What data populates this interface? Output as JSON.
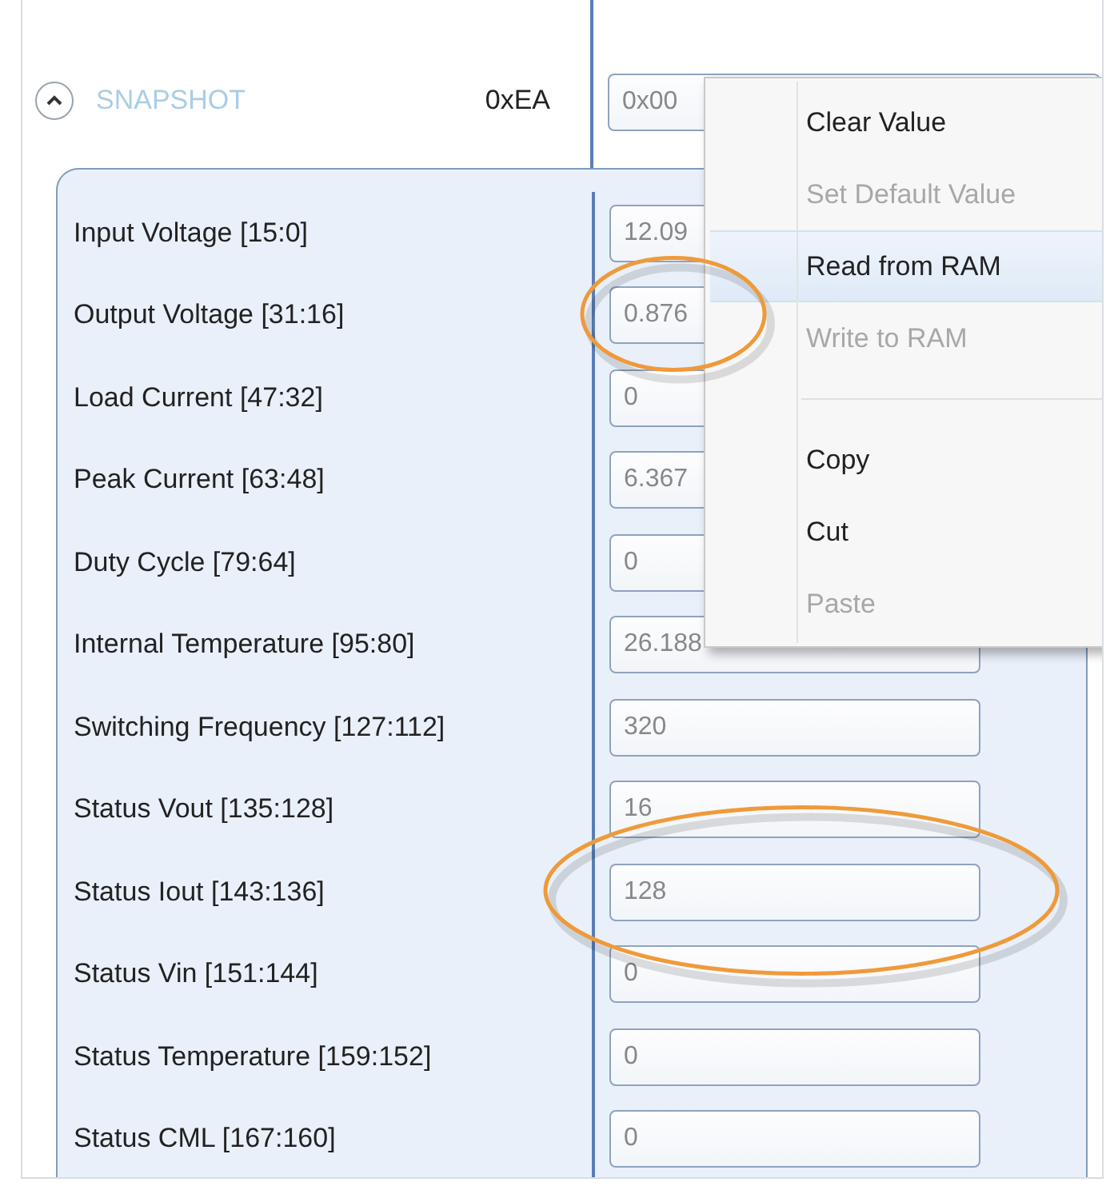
{
  "section": {
    "title": "SNAPSHOT",
    "expanded": true,
    "address": "0xEA",
    "value": "0x00"
  },
  "fields": [
    {
      "label": "Input Voltage [15:0]",
      "value": "12.09",
      "circled": false
    },
    {
      "label": "Output Voltage [31:16]",
      "value": "0.876",
      "circled": true
    },
    {
      "label": "Load Current [47:32]",
      "value": "0",
      "circled": false
    },
    {
      "label": "Peak Current [63:48]",
      "value": "6.367",
      "circled": false
    },
    {
      "label": "Duty Cycle [79:64]",
      "value": "0",
      "circled": false
    },
    {
      "label": "Internal Temperature [95:80]",
      "value": "26.188",
      "circled": false
    },
    {
      "label": "Switching Frequency [127:112]",
      "value": "320",
      "circled": false
    },
    {
      "label": "Status Vout [135:128]",
      "value": "16",
      "circled": false
    },
    {
      "label": "Status Iout [143:136]",
      "value": "128",
      "circled": true
    },
    {
      "label": "Status Vin [151:144]",
      "value": "0",
      "circled": false
    },
    {
      "label": "Status Temperature [159:152]",
      "value": "0",
      "circled": false
    },
    {
      "label": "Status CML [167:160]",
      "value": "0",
      "circled": false
    }
  ],
  "context_menu": [
    {
      "kind": "item",
      "label": "Clear Value",
      "disabled": false,
      "selected": false
    },
    {
      "kind": "item",
      "label": "Set Default Value",
      "disabled": true,
      "selected": false
    },
    {
      "kind": "item",
      "label": "Read from RAM",
      "disabled": false,
      "selected": true
    },
    {
      "kind": "item",
      "label": "Write to RAM",
      "disabled": true,
      "selected": false
    },
    {
      "kind": "separator"
    },
    {
      "kind": "item",
      "label": "Copy",
      "disabled": false,
      "selected": false
    },
    {
      "kind": "item",
      "label": "Cut",
      "disabled": false,
      "selected": false
    },
    {
      "kind": "item",
      "label": "Paste",
      "disabled": true,
      "selected": false
    }
  ]
}
